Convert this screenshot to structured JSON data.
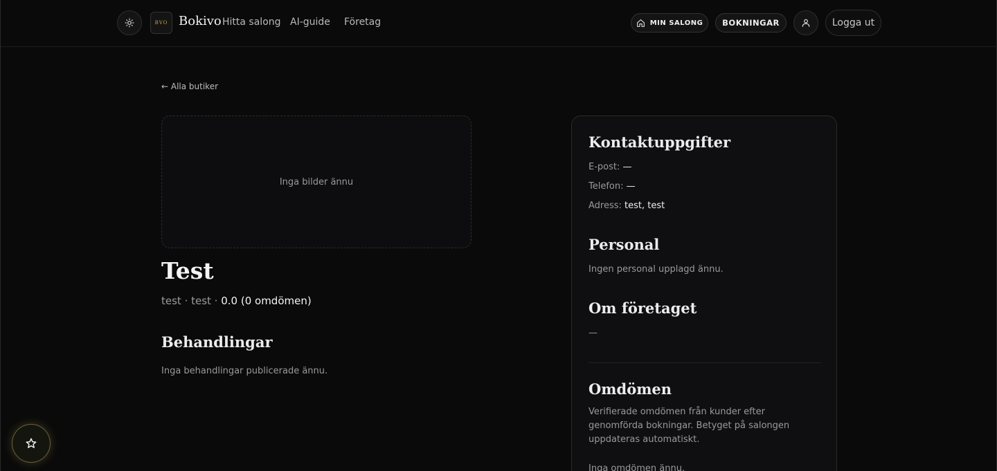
{
  "header": {
    "logo_text": "BVO",
    "brand": "Bokivo",
    "nav": [
      "Hitta salong",
      "AI-guide",
      "Företag"
    ],
    "my_salon": "MIN SALONG",
    "bookings": "BOKNINGAR",
    "logout": "Logga ut"
  },
  "back_link": "← Alla butiker",
  "gallery_empty": "Inga bilder ännu",
  "salon": {
    "name": "Test",
    "meta_prefix": "test · test · ",
    "rating_text": "0.0 (0 omdömen)"
  },
  "treatments": {
    "heading": "Behandlingar",
    "empty": "Inga behandlingar publicerade ännu."
  },
  "contact": {
    "heading": "Kontaktuppgifter",
    "email_label": "E-post:",
    "email_value": "—",
    "phone_label": "Telefon:",
    "phone_value": "—",
    "address_label": "Adress:",
    "address_value": "test, test"
  },
  "staff": {
    "heading": "Personal",
    "empty": "Ingen personal upplagd ännu."
  },
  "about": {
    "heading": "Om företaget",
    "text": "—"
  },
  "reviews": {
    "heading": "Omdömen",
    "description": "Verifierade omdömen från kunder efter genomförda bokningar. Betyget på salongen uppdateras automatiskt.",
    "empty": "Inga omdömen ännu."
  },
  "icons": {
    "theme": "sun-icon",
    "home": "home-icon",
    "user": "user-icon",
    "fab": "star-icon"
  },
  "colors": {
    "background": "#0a0a0a",
    "accent_gold": "#c8a24a"
  }
}
